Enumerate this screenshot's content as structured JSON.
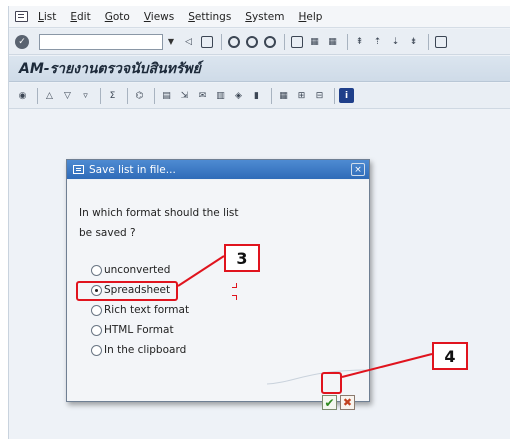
{
  "menubar": {
    "items": [
      {
        "label": "List",
        "ul": "L",
        "rest": "ist"
      },
      {
        "label": "Edit",
        "ul": "E",
        "rest": "dit"
      },
      {
        "label": "Goto",
        "ul": "G",
        "rest": "oto"
      },
      {
        "label": "Views",
        "ul": "V",
        "rest": "iews"
      },
      {
        "label": "Settings",
        "ul": "S",
        "rest": "ettings"
      },
      {
        "label": "System",
        "ul": "S",
        "rest": "ystem"
      },
      {
        "label": "Help",
        "ul": "H",
        "rest": "elp"
      }
    ]
  },
  "toolbar1": {
    "command_value": "",
    "icons": [
      "back-icon",
      "save-icon",
      "green-circle-icon",
      "exit-icon",
      "cancel-icon",
      "print-icon",
      "find-icon",
      "find-next-icon",
      "first-page-icon",
      "prev-page-icon",
      "next-page-icon",
      "last-page-icon",
      "new-session-icon"
    ]
  },
  "title": "AM-รายงานตรวจนับสินทรัพย์",
  "toolbar2": {
    "icons": [
      "detail-icon",
      "sort-asc-icon",
      "filter-icon",
      "filter-set-icon",
      "sum-icon",
      "subtotal-icon",
      "layout-icon",
      "export-icon",
      "mail-icon",
      "spreadsheet-icon",
      "abc-icon",
      "graphic-icon",
      "grid-icon",
      "insert-col-icon",
      "delete-col-icon",
      "info-icon"
    ]
  },
  "dialog": {
    "title": "Save list in file...",
    "close_label": "×",
    "question_line1": "In which format should the list",
    "question_line2": "be saved ?",
    "options": [
      {
        "label": "unconverted",
        "selected": false
      },
      {
        "label": "Spreadsheet",
        "selected": true
      },
      {
        "label": "Rich text format",
        "selected": false
      },
      {
        "label": "HTML Format",
        "selected": false
      },
      {
        "label": "In the clipboard",
        "selected": false
      }
    ],
    "ok_label": "✔",
    "cancel_label": "✖"
  },
  "callouts": {
    "step3": "3",
    "step4": "4"
  },
  "colors": {
    "accent_red": "#e0141e",
    "dialog_title_blue": "#2f6bb8"
  }
}
